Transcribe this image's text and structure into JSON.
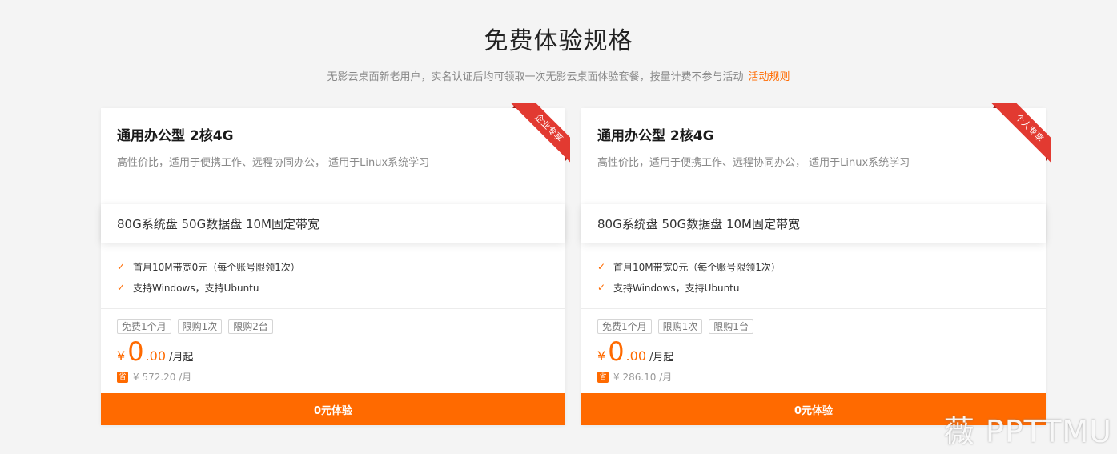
{
  "header": {
    "title": "免费体验规格",
    "subtitle": "无影云桌面新老用户，实名认证后均可领取一次无影云桌面体验套餐，按量计费不参与活动",
    "rules_link": "活动规则"
  },
  "cards": [
    {
      "ribbon": "企业专享",
      "title": "通用办公型 2核4G",
      "description": "高性价比，适用于便携工作、远程协同办公， 适用于Linux系统学习",
      "spec": "80G系统盘 50G数据盘 10M固定带宽",
      "features": [
        "首月10M带宽0元（每个账号限领1次）",
        "支持Windows，支持Ubuntu"
      ],
      "tags": [
        "免费1个月",
        "限购1次",
        "限购2台"
      ],
      "price": {
        "currency": "¥",
        "integer": "0",
        "decimal": ".00",
        "unit": "/月起"
      },
      "save_badge": "省",
      "original_price": "¥ 572.20 /月",
      "cta": "0元体验"
    },
    {
      "ribbon": "个人专享",
      "title": "通用办公型 2核4G",
      "description": "高性价比，适用于便携工作、远程协同办公， 适用于Linux系统学习",
      "spec": "80G系统盘 50G数据盘 10M固定带宽",
      "features": [
        "首月10M带宽0元（每个账号限领1次）",
        "支持Windows，支持Ubuntu"
      ],
      "tags": [
        "免费1个月",
        "限购1次",
        "限购1台"
      ],
      "price": {
        "currency": "¥",
        "integer": "0",
        "decimal": ".00",
        "unit": "/月起"
      },
      "save_badge": "省",
      "original_price": "¥ 286.10 /月",
      "cta": "0元体验"
    }
  ],
  "watermark": "薇 PPTTMU",
  "colors": {
    "accent": "#ff6a00",
    "ribbon": "#e23a31",
    "background": "#f4f4f4"
  },
  "icons": {
    "feature": "check-icon"
  }
}
